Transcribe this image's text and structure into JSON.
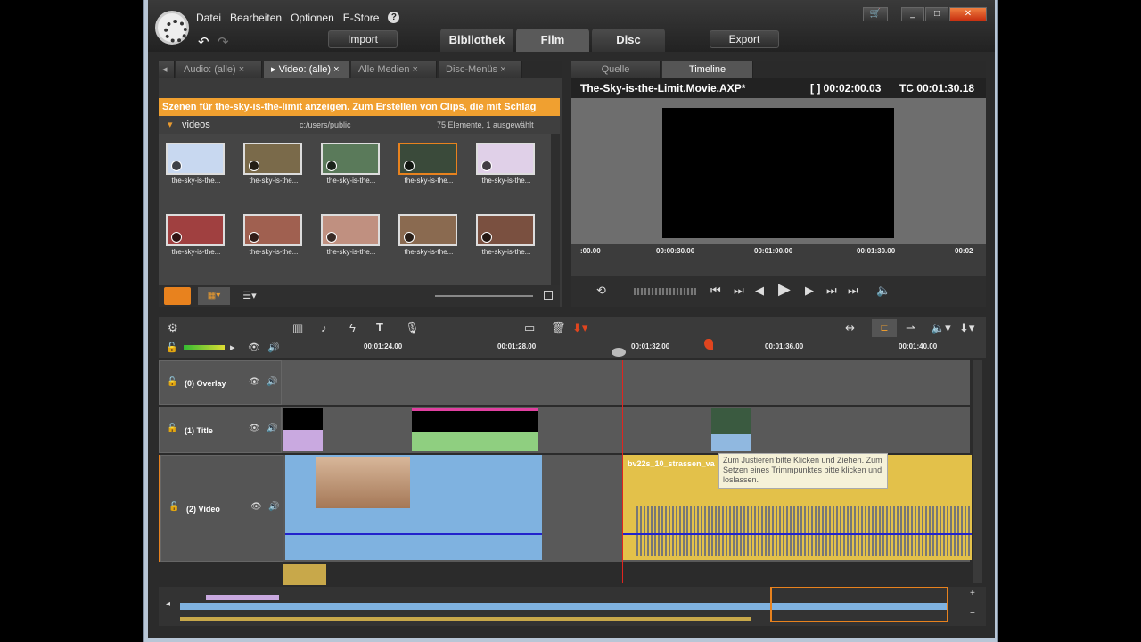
{
  "menu": {
    "items": [
      "Datei",
      "Bearbeiten",
      "Optionen",
      "E-Store"
    ],
    "help": "?"
  },
  "toolbar": {
    "import": "Import",
    "export": "Export"
  },
  "main_tabs": [
    "Bibliothek",
    "Film",
    "Disc"
  ],
  "library": {
    "tabs": [
      "Audio: (alle)",
      "Video: (alle)",
      "Alle Medien",
      "Disc-Menüs"
    ],
    "banner": "Szenen für the-sky-is-the-limit anzeigen. Zum Erstellen von Clips, die mit Schlag",
    "folder": "videos",
    "path": "c:/users/public",
    "count": "75 Elemente, 1 ausgewählt",
    "thumb_label": "the-sky-is-the..."
  },
  "preview": {
    "tabs": [
      "Quelle",
      "Timeline"
    ],
    "title": "The-Sky-is-the-Limit.Movie.AXP*",
    "duration": "[ ] 00:02:00.03",
    "tc": "TC 00:01:30.18",
    "ruler": [
      ":00.00",
      "00:00:30.00",
      "00:01:00.00",
      "00:01:30.00",
      "00:02"
    ]
  },
  "timeline": {
    "ruler": [
      "00:01:24.00",
      "00:01:28.00",
      "00:01:32.00",
      "00:01:36.00",
      "00:01:40.00"
    ],
    "tracks": [
      "(0) Overlay",
      "(1) Title",
      "(2) Video"
    ],
    "clip_name": "bv22s_10_strassen_va",
    "tooltip": "Zum Justieren bitte Klicken und Ziehen. Zum Setzen eines Trimmpunktes bitte klicken und loslassen."
  }
}
